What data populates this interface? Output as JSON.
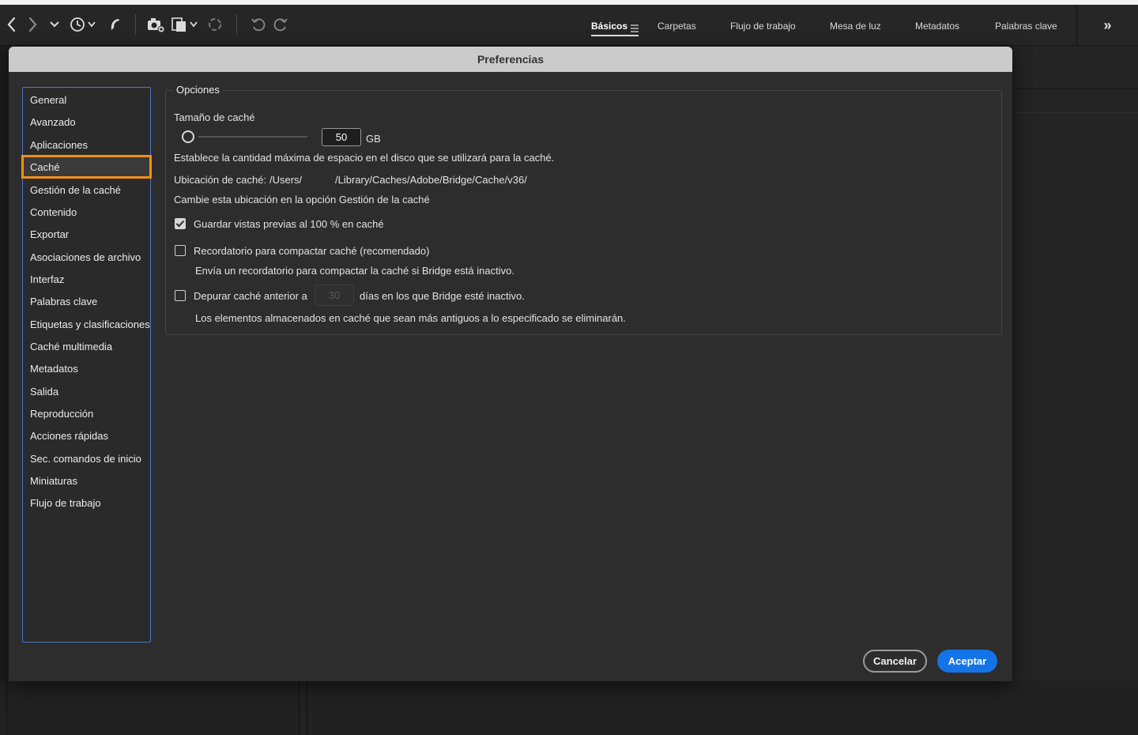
{
  "toolbar": {
    "icons": [
      "back-icon",
      "forward-icon",
      "chevron-down-icon",
      "recent-history-icon",
      "boomerang-icon",
      "get-photos-camera-icon",
      "copy-files-icon",
      "refine-icon",
      "rotate-left-icon",
      "rotate-right-icon"
    ],
    "workspaces": [
      {
        "label": "Básicos",
        "active": true
      },
      {
        "label": "Carpetas",
        "active": false
      },
      {
        "label": "Flujo de trabajo",
        "active": false
      },
      {
        "label": "Mesa de luz",
        "active": false
      },
      {
        "label": "Metadatos",
        "active": false
      },
      {
        "label": "Palabras clave",
        "active": false
      }
    ],
    "more_label": "»"
  },
  "dialog": {
    "title": "Preferencias",
    "sidebar": {
      "items": [
        "General",
        "Avanzado",
        "Aplicaciones",
        "Caché",
        "Gestión de la caché",
        "Contenido",
        "Exportar",
        "Asociaciones de archivo",
        "Interfaz",
        "Palabras clave",
        "Etiquetas y clasificaciones",
        "Caché multimedia",
        "Metadatos",
        "Salida",
        "Reproducción",
        "Acciones rápidas",
        "Sec. comandos de inicio",
        "Miniaturas",
        "Flujo de trabajo"
      ],
      "selected": "Caché"
    },
    "options": {
      "group_label": "Opciones",
      "cache_size_label": "Tamaño de caché",
      "cache_size_value": "50",
      "cache_size_unit": "GB",
      "cache_size_desc": "Establece la cantidad máxima de espacio en el disco que se utilizará para la caché.",
      "location_label": "Ubicación de caché:",
      "location_path_start": "/Users/",
      "location_path_end": "/Library/Caches/Adobe/Bridge/Cache/v36/",
      "location_hint": "Cambie esta ubicación en la opción Gestión de la caché",
      "save_previews_label": "Guardar vistas previas al 100 % en caché",
      "save_previews_checked": true,
      "compact_reminder_label": "Recordatorio para compactar caché (recomendado)",
      "compact_reminder_checked": false,
      "compact_reminder_desc": "Envía un recordatorio para compactar la caché si Bridge está inactivo.",
      "purge_label_before": "Depurar caché anterior a",
      "purge_days_value": "30",
      "purge_label_after": "días en los que Bridge esté inactivo.",
      "purge_checked": false,
      "purge_desc": "Los elementos almacenados en caché que sean más antiguos a lo especificado se eliminarán."
    },
    "buttons": {
      "cancel": "Cancelar",
      "ok": "Aceptar"
    },
    "colors": {
      "accent": "#1473e6",
      "selection_outline": "#f29111",
      "sidebar_border": "#4a78c8"
    }
  }
}
